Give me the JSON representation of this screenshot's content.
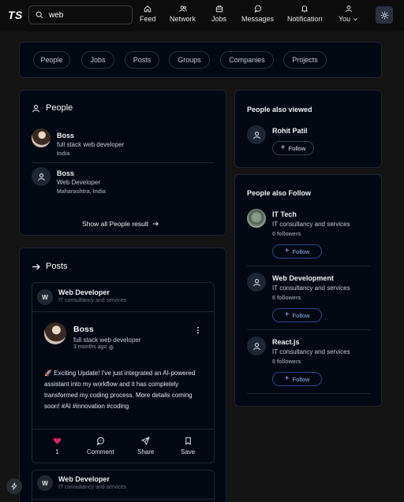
{
  "header": {
    "logo": "TS",
    "search": {
      "value": "web",
      "placeholder": ""
    },
    "nav": [
      {
        "label": "Feed",
        "icon": "home-icon"
      },
      {
        "label": "Network",
        "icon": "users-icon"
      },
      {
        "label": "Jobs",
        "icon": "briefcase-icon"
      },
      {
        "label": "Messages",
        "icon": "message-icon"
      },
      {
        "label": "Notification",
        "icon": "bell-icon"
      },
      {
        "label": "You",
        "icon": "user-icon"
      }
    ]
  },
  "filters": [
    "People",
    "Jobs",
    "Posts",
    "Groups",
    "Companies",
    "Projects"
  ],
  "people": {
    "title": "People",
    "results": [
      {
        "name": "Boss",
        "headline": "full stack web developer",
        "location": "India"
      },
      {
        "name": "Boss",
        "headline": "Web Developer",
        "location": "Maharashtra, India"
      }
    ],
    "show_all": "Show all People result"
  },
  "posts": {
    "title": "Posts",
    "items": [
      {
        "group": "Web Developer",
        "group_sub": "IT consultancy and services",
        "author": "Boss",
        "author_headline": "full stack web developer",
        "time": "3 months ago",
        "body": "🚀 Exciting Update! I've just integrated an AI-powered assistant into my workflow and it has completely transformed my coding process. More details coming soon! #AI #innovation #coding",
        "like_count": "1",
        "comment_label": "Comment",
        "share_label": "Share",
        "save_label": "Save"
      },
      {
        "group": "Web Developer",
        "group_sub": "IT consultancy and services"
      }
    ]
  },
  "also_viewed": {
    "title": "People also viewed",
    "items": [
      {
        "name": "Rohit Patil",
        "button": "Follow"
      }
    ]
  },
  "also_follow": {
    "title": "People also Follow",
    "items": [
      {
        "name": "IT Tech",
        "industry": "IT consultancy and services",
        "followers": "0 followers",
        "button": "Follow"
      },
      {
        "name": "Web Development",
        "industry": "IT consultancy and services",
        "followers": "0 followers",
        "button": "Follow"
      },
      {
        "name": "React.js",
        "industry": "IT consultancy and services",
        "followers": "0 followers",
        "button": "Follow"
      }
    ]
  },
  "colors": {
    "background": "#141414",
    "card": "#030812",
    "accent": "#3b6fd8",
    "like": "#e0245e"
  }
}
